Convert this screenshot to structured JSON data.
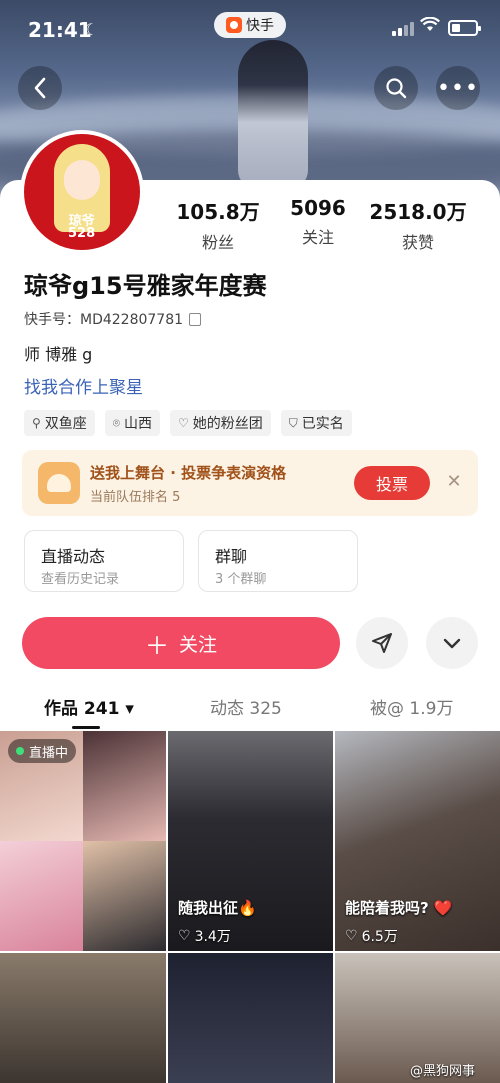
{
  "status_bar": {
    "time": "21:41",
    "app_pill": "快手"
  },
  "profile": {
    "avatar_text": "琼爷\n528",
    "stats": [
      {
        "value": "105.8万",
        "label": "粉丝"
      },
      {
        "value": "5096",
        "label": "关注"
      },
      {
        "value": "2518.0万",
        "label": "获赞"
      }
    ],
    "name": "琼爷g15号雅家年度赛",
    "uid": "快手号：MD422807781",
    "bio": "师 博雅 g",
    "star_link": "找我合作上聚星",
    "tags": [
      "双鱼座",
      "山西",
      "她的粉丝团",
      "已实名"
    ]
  },
  "vote_banner": {
    "title": "送我上舞台 · 投票争表演资格",
    "subtitle": "当前队伍排名 5",
    "button": "投票"
  },
  "cards": [
    {
      "title": "直播动态",
      "subtitle": "查看历史记录"
    },
    {
      "title": "群聊",
      "subtitle": "3 个群聊"
    }
  ],
  "actions": {
    "follow": "关注"
  },
  "tabs": [
    {
      "label": "作品 241 ▾"
    },
    {
      "label": "动态 325"
    },
    {
      "label": "被@ 1.9万"
    }
  ],
  "videos": [
    {
      "badge": "直播中"
    },
    {
      "caption": "随我出征🔥",
      "likes": "3.4万"
    },
    {
      "caption": "能陪着我吗? ❤️",
      "likes": "6.5万"
    }
  ],
  "watermark": "@黑狗网事"
}
